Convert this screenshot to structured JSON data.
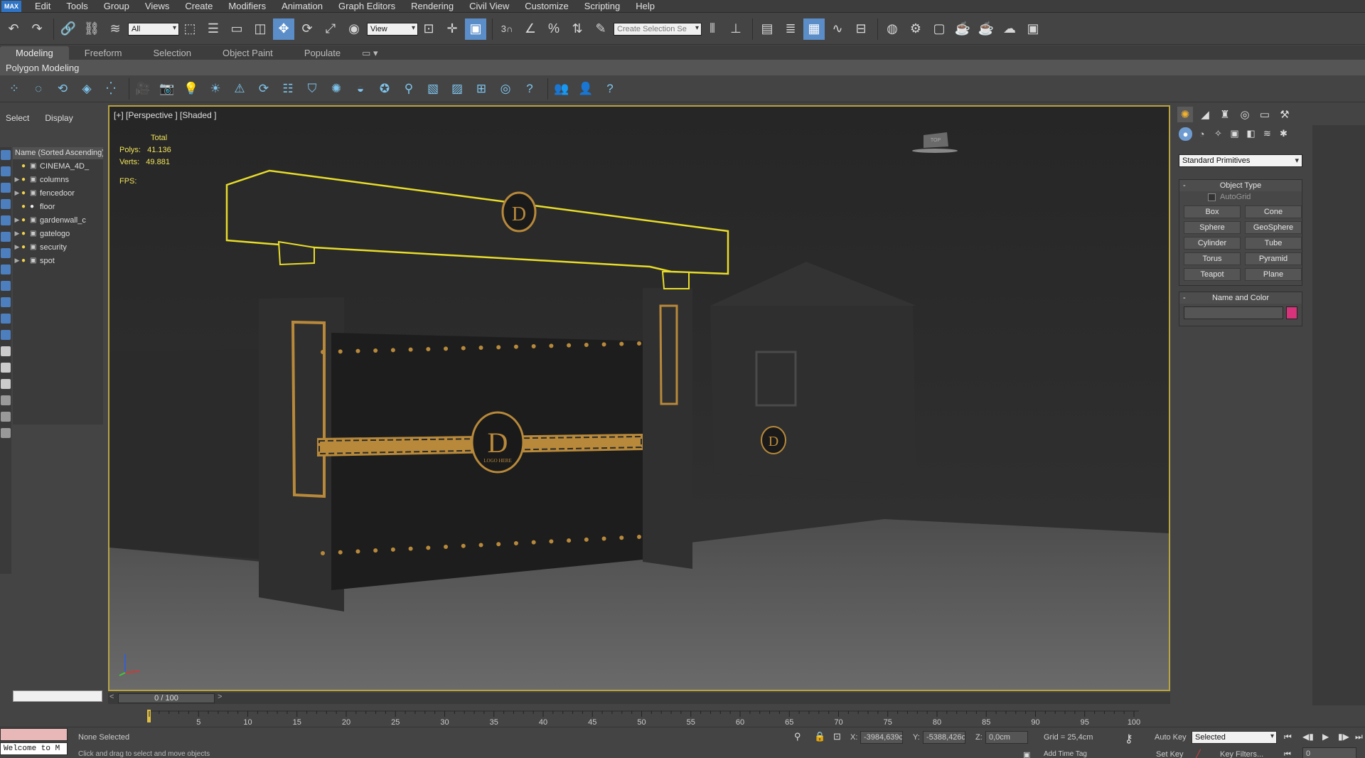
{
  "app": {
    "logo": "MAX"
  },
  "menu": [
    "Edit",
    "Tools",
    "Group",
    "Views",
    "Create",
    "Modifiers",
    "Animation",
    "Graph Editors",
    "Rendering",
    "Civil View",
    "Customize",
    "Scripting",
    "Help"
  ],
  "toolbar": {
    "selection_filter": "All",
    "ref_coord": "View",
    "snap_label": "3",
    "selection_set_placeholder": "Create Selection Se"
  },
  "ribbon": {
    "tabs": [
      "Modeling",
      "Freeform",
      "Selection",
      "Object Paint",
      "Populate"
    ],
    "active_tab": "Modeling",
    "panel_label": "Polygon Modeling"
  },
  "explorer": {
    "tabs": [
      "Select",
      "Display"
    ],
    "column_header": "Name (Sorted Ascending)",
    "items": [
      {
        "name": "CINEMA_4D_",
        "expand": ""
      },
      {
        "name": "columns",
        "expand": "▶"
      },
      {
        "name": "fencedoor",
        "expand": "▶"
      },
      {
        "name": "floor",
        "expand": ""
      },
      {
        "name": "gardenwall_c",
        "expand": "▶"
      },
      {
        "name": "gatelogo",
        "expand": "▶"
      },
      {
        "name": "security",
        "expand": "▶"
      },
      {
        "name": "spot",
        "expand": "▶"
      }
    ]
  },
  "viewport": {
    "label": "[+] [Perspective ] [Shaded ]",
    "stats": {
      "total_label": "Total",
      "polys_label": "Polys:",
      "polys": "41.136",
      "verts_label": "Verts:",
      "verts": "49.881",
      "fps_label": "FPS:"
    },
    "viewcube_label": "TOP",
    "logo_letter": "D",
    "logo_text": "LOGO HERE",
    "floor_color": "#5f5f5f",
    "selection_color": "#e8dc2a",
    "gold_color": "#b8893a"
  },
  "command_panel": {
    "dropdown": "Standard Primitives",
    "object_type_title": "Object Type",
    "autogrid": "AutoGrid",
    "primitives": [
      "Box",
      "Cone",
      "Sphere",
      "GeoSphere",
      "Cylinder",
      "Tube",
      "Torus",
      "Pyramid",
      "Teapot",
      "Plane"
    ],
    "name_color_title": "Name and Color",
    "object_color": "#d6337b"
  },
  "timeline": {
    "frame_display": "0 / 100",
    "ticks": [
      "5",
      "10",
      "15",
      "20",
      "25",
      "30",
      "35",
      "40",
      "45",
      "50",
      "55",
      "60",
      "65",
      "70",
      "75",
      "80",
      "85",
      "90",
      "95",
      "100"
    ]
  },
  "status": {
    "maxscript": "Welcome to M",
    "selection": "None Selected",
    "prompt": "Click and drag to select and move objects",
    "x_label": "X:",
    "x": "-3984,639c",
    "y_label": "Y:",
    "y": "-5388,426c",
    "z_label": "Z:",
    "z": "0,0cm",
    "grid": "Grid = 25,4cm",
    "add_time_tag": "Add Time Tag",
    "auto_key": "Auto Key",
    "key_mode": "Selected",
    "set_key": "Set Key",
    "key_filters": "Key Filters...",
    "frame": "0"
  }
}
